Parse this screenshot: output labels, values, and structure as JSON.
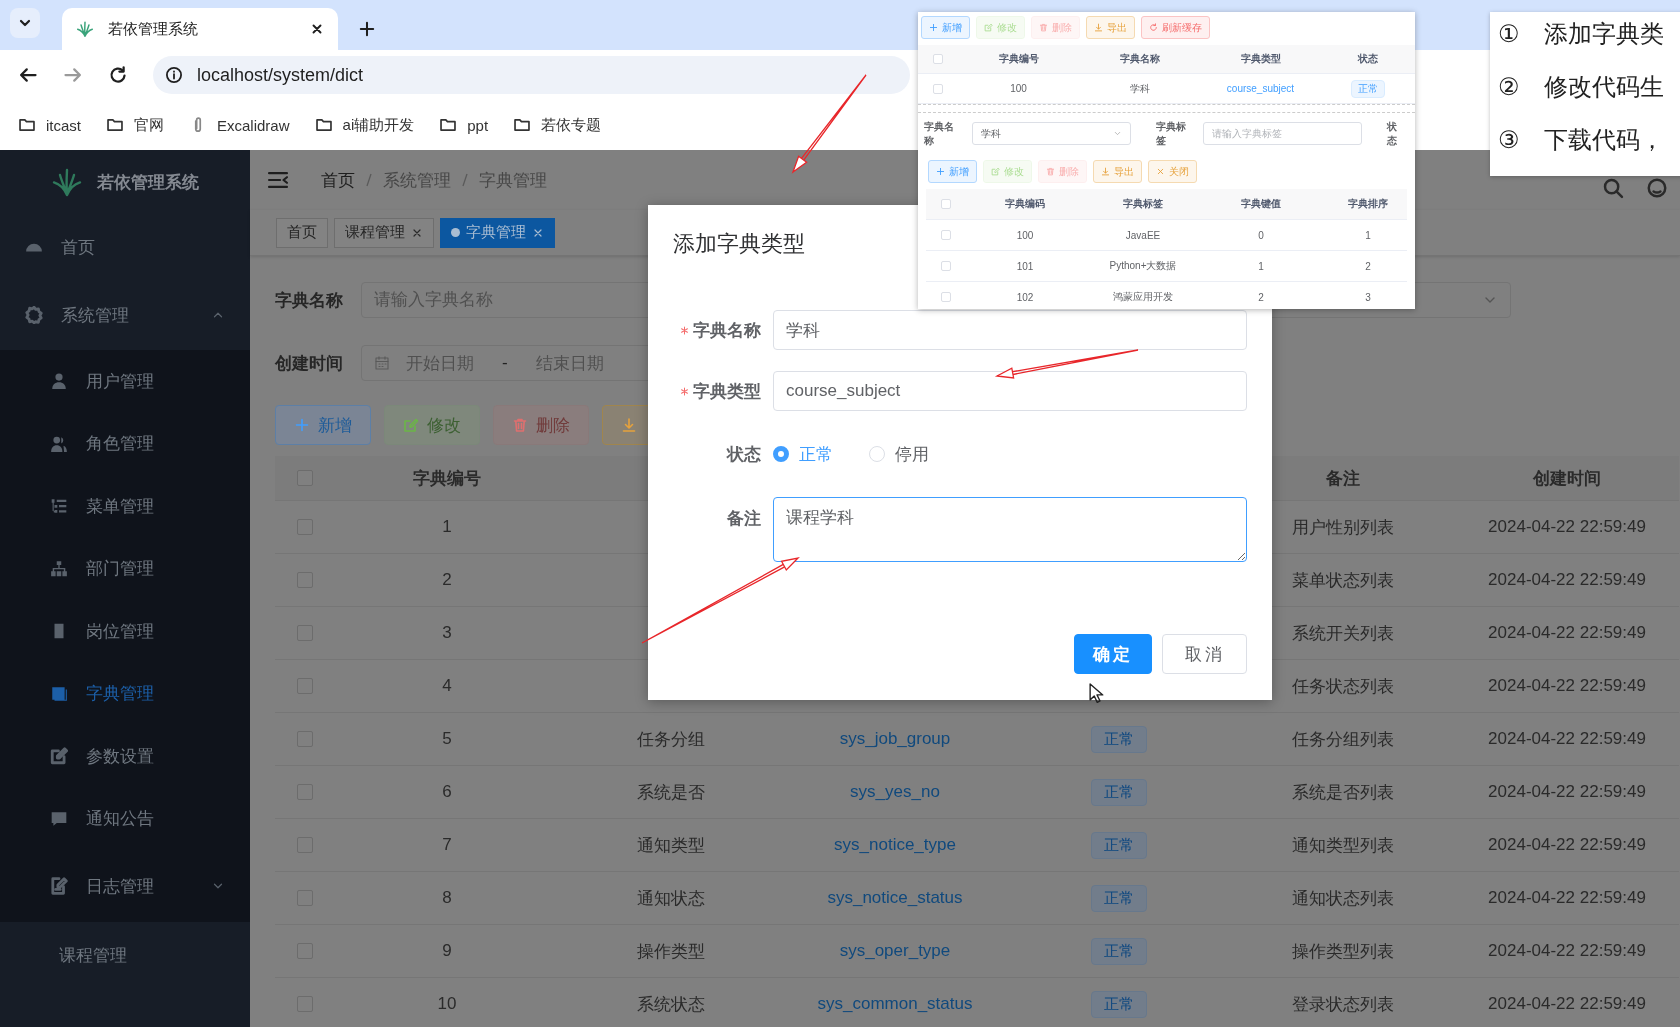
{
  "browser": {
    "tabs": [
      {
        "title": "若依管理系统",
        "selected": true
      }
    ],
    "url": "localhost/system/dict",
    "bookmarks": [
      {
        "label": "itcast",
        "kind": "folder"
      },
      {
        "label": "官网",
        "kind": "folder"
      },
      {
        "label": "Excalidraw",
        "kind": "site"
      },
      {
        "label": "ai辅助开发",
        "kind": "folder"
      },
      {
        "label": "ppt",
        "kind": "folder"
      },
      {
        "label": "若依专题",
        "kind": "folder"
      }
    ]
  },
  "sidebar": {
    "title": "若依管理系统",
    "items": [
      {
        "label": "首页",
        "selected": false
      },
      {
        "label": "系统管理",
        "selected": false,
        "expanded": true,
        "children": [
          {
            "label": "用户管理",
            "selected": false
          },
          {
            "label": "角色管理",
            "selected": false
          },
          {
            "label": "菜单管理",
            "selected": false
          },
          {
            "label": "部门管理",
            "selected": false
          },
          {
            "label": "岗位管理",
            "selected": false
          },
          {
            "label": "字典管理",
            "selected": true
          },
          {
            "label": "参数设置",
            "selected": false
          },
          {
            "label": "通知公告",
            "selected": false
          },
          {
            "label": "日志管理",
            "selected": false,
            "expanded": false
          }
        ]
      },
      {
        "label": "课程管理",
        "selected": false
      }
    ]
  },
  "breadcrumb": [
    "首页",
    "系统管理",
    "字典管理"
  ],
  "tags": [
    {
      "label": "首页",
      "selected": false,
      "closable": false
    },
    {
      "label": "课程管理",
      "selected": false,
      "closable": true
    },
    {
      "label": "字典管理",
      "selected": true,
      "closable": true
    }
  ],
  "filter": {
    "name": {
      "label": "字典名称",
      "placeholder": "请输入字典名称"
    },
    "created": {
      "label": "创建时间",
      "start_placeholder": "开始日期",
      "separator": "-",
      "end_placeholder": "结束日期"
    }
  },
  "toolbar": [
    {
      "label": "新增",
      "kind": "add",
      "disabled": false
    },
    {
      "label": "修改",
      "kind": "edit",
      "disabled": true
    },
    {
      "label": "删除",
      "kind": "delete",
      "disabled": true
    },
    {
      "kind": "export",
      "disabled": false
    }
  ],
  "table": {
    "header_checked": false,
    "columns": [
      "字典编号",
      "备注",
      "创建时间"
    ],
    "rows": [
      {
        "checked": false,
        "id": "1",
        "remark": "用户性别列表",
        "created": "2024-04-22 22:59:49"
      },
      {
        "checked": false,
        "id": "2",
        "remark": "菜单状态列表",
        "created": "2024-04-22 22:59:49"
      },
      {
        "checked": false,
        "id": "3",
        "remark": "系统开关列表",
        "created": "2024-04-22 22:59:49"
      },
      {
        "checked": false,
        "id": "4",
        "remark": "任务状态列表",
        "created": "2024-04-22 22:59:49"
      },
      {
        "checked": false,
        "id": "5",
        "name": "任务分组",
        "type": "sys_job_group",
        "status": "正常",
        "remark": "任务分组列表",
        "created": "2024-04-22 22:59:49"
      },
      {
        "checked": false,
        "id": "6",
        "name": "系统是否",
        "type": "sys_yes_no",
        "status": "正常",
        "remark": "系统是否列表",
        "created": "2024-04-22 22:59:49"
      },
      {
        "checked": false,
        "id": "7",
        "name": "通知类型",
        "type": "sys_notice_type",
        "status": "正常",
        "remark": "通知类型列表",
        "created": "2024-04-22 22:59:49"
      },
      {
        "checked": false,
        "id": "8",
        "name": "通知状态",
        "type": "sys_notice_status",
        "status": "正常",
        "remark": "通知状态列表",
        "created": "2024-04-22 22:59:49"
      },
      {
        "checked": false,
        "id": "9",
        "name": "操作类型",
        "type": "sys_oper_type",
        "status": "正常",
        "remark": "操作类型列表",
        "created": "2024-04-22 22:59:49"
      },
      {
        "checked": false,
        "id": "10",
        "name": "系统状态",
        "type": "sys_common_status",
        "status": "正常",
        "remark": "登录状态列表",
        "created": "2024-04-22 22:59:49"
      }
    ]
  },
  "dialog": {
    "title": "添加字典类型",
    "fields": [
      {
        "kind": "input",
        "label": "字典名称",
        "required": true,
        "value": "学科"
      },
      {
        "kind": "input",
        "label": "字典类型",
        "required": true,
        "value": "course_subject"
      },
      {
        "kind": "radio",
        "label": "状态",
        "required": false,
        "options": [
          {
            "label": "正常",
            "selected": true
          },
          {
            "label": "停用",
            "selected": false
          }
        ]
      },
      {
        "kind": "textarea",
        "label": "备注",
        "required": false,
        "value": "课程学科"
      }
    ],
    "buttons": [
      {
        "label": "确定",
        "kind": "primary"
      },
      {
        "label": "取消",
        "kind": "default"
      }
    ]
  },
  "inset": {
    "toolbar": [
      {
        "label": "新增",
        "kind": "add",
        "disabled": false
      },
      {
        "label": "修改",
        "kind": "edit",
        "disabled": true
      },
      {
        "label": "删除",
        "kind": "delete",
        "disabled": true
      },
      {
        "label": "导出",
        "kind": "export",
        "disabled": false
      },
      {
        "label": "刷新缓存",
        "kind": "refresh",
        "disabled": false
      }
    ],
    "type_table": {
      "header_checked": false,
      "columns": [
        "字典编号",
        "字典名称",
        "字典类型",
        "状态"
      ],
      "rows": [
        {
          "checked": false,
          "id": "100",
          "name": "学科",
          "type": "course_subject",
          "status": "正常"
        }
      ]
    },
    "filter": [
      {
        "label": "字典名称",
        "kind": "select",
        "value": "学科"
      },
      {
        "label": "字典标签",
        "kind": "input",
        "placeholder": "请输入字典标签"
      },
      {
        "label": "状态",
        "kind": "label"
      }
    ],
    "toolbar2": [
      {
        "label": "新增",
        "kind": "add",
        "disabled": false
      },
      {
        "label": "修改",
        "kind": "edit",
        "disabled": true
      },
      {
        "label": "删除",
        "kind": "delete",
        "disabled": true
      },
      {
        "label": "导出",
        "kind": "export",
        "disabled": false
      },
      {
        "label": "关闭",
        "kind": "close",
        "disabled": false
      }
    ],
    "data_table": {
      "header_checked": false,
      "columns": [
        "字典编码",
        "字典标签",
        "字典键值",
        "字典排序"
      ],
      "rows": [
        {
          "checked": false,
          "code": "100",
          "label": "JavaEE",
          "value": "0",
          "sort": "1"
        },
        {
          "checked": false,
          "code": "101",
          "label": "Python+大数据",
          "value": "1",
          "sort": "2"
        },
        {
          "checked": false,
          "code": "102",
          "label": "鸿蒙应用开发",
          "value": "2",
          "sort": "3"
        }
      ]
    }
  },
  "notes": [
    {
      "number": "①",
      "text": "添加字典类"
    },
    {
      "number": "②",
      "text": "修改代码生"
    },
    {
      "number": "③",
      "text": "下载代码，"
    }
  ]
}
